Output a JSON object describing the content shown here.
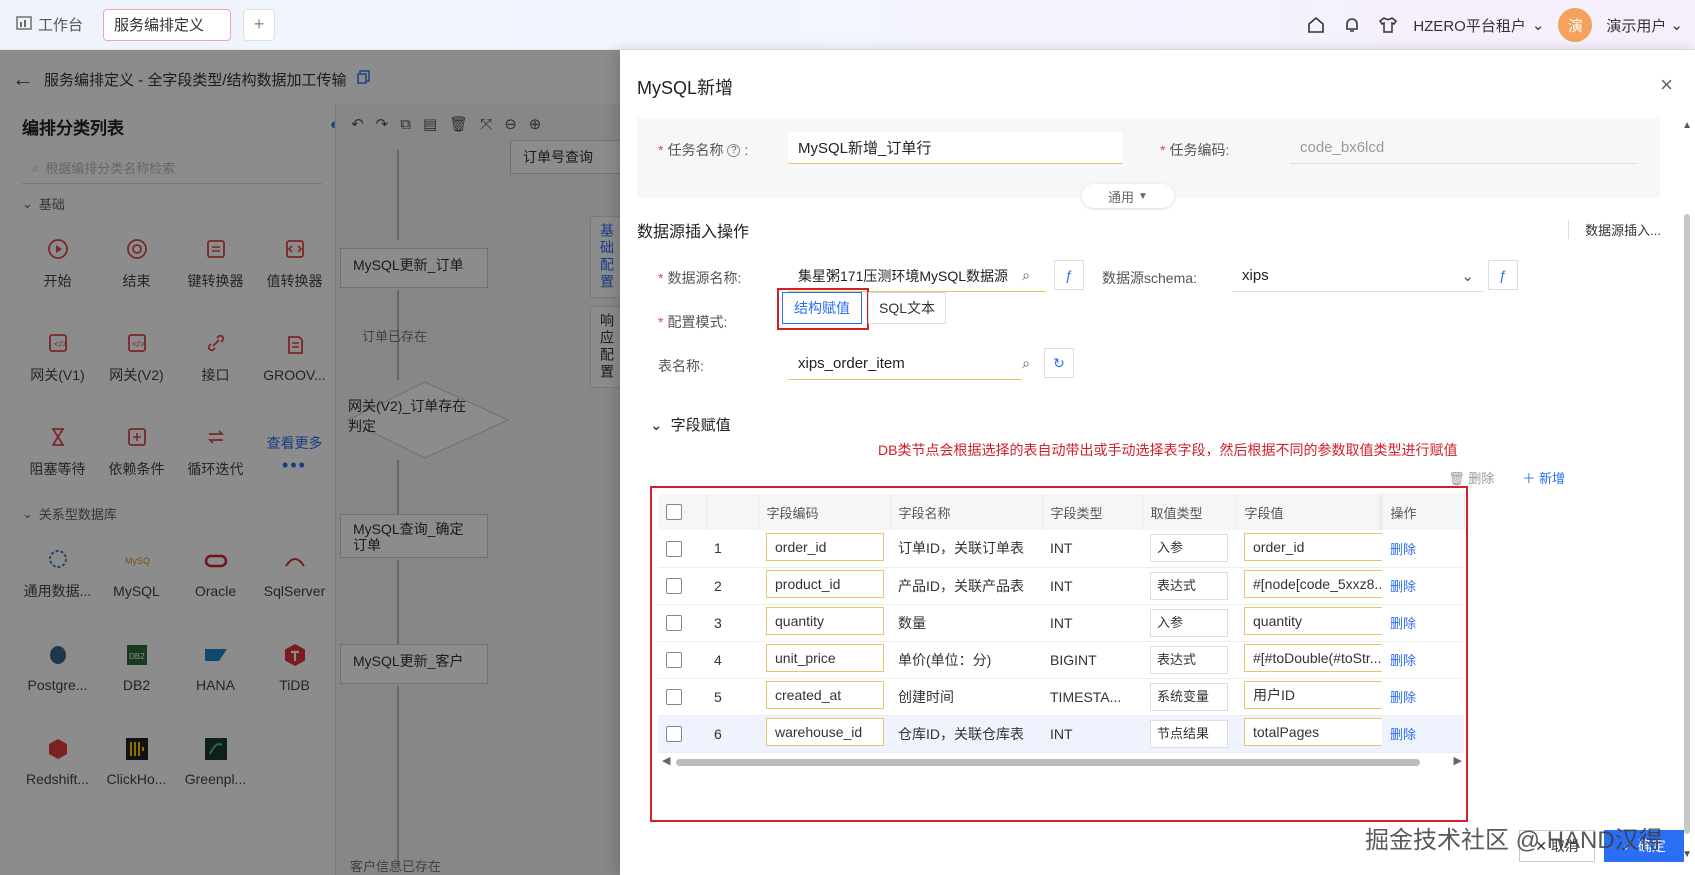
{
  "topbar": {
    "home_tab": "工作台",
    "active_tab": "服务编排定义",
    "add_tab": "+",
    "tenant": "HZERO平台租户",
    "avatar_text": "演",
    "username": "演示用户"
  },
  "breadcrumb": {
    "title": "服务编排定义 - 全字段类型/结构数据加工传输"
  },
  "catalog": {
    "title": "编排分类列表",
    "search_placeholder": "根据编排分类名称检索",
    "group_basic": "基础",
    "basic_items": [
      {
        "label": "开始",
        "icon": "play-circle-icon"
      },
      {
        "label": "结束",
        "icon": "stop-circle-icon"
      },
      {
        "label": "键转换器",
        "icon": "key-convert-icon"
      },
      {
        "label": "值转换器",
        "icon": "value-convert-icon"
      },
      {
        "label": "网关(V1)",
        "icon": "gateway-v1-icon"
      },
      {
        "label": "网关(V2)",
        "icon": "gateway-v2-icon"
      },
      {
        "label": "接口",
        "icon": "link-icon"
      },
      {
        "label": "GROOV...",
        "icon": "groovy-icon"
      },
      {
        "label": "阻塞等待",
        "icon": "hourglass-icon"
      },
      {
        "label": "依赖条件",
        "icon": "dependency-icon"
      },
      {
        "label": "循环迭代",
        "icon": "loop-icon"
      },
      {
        "label": "查看更多",
        "icon": "more-icon"
      }
    ],
    "group_db": "关系型数据库",
    "db_items": [
      {
        "label": "通用数据...",
        "icon": "generic-db-icon"
      },
      {
        "label": "MySQL",
        "icon": "mysql-icon"
      },
      {
        "label": "Oracle",
        "icon": "oracle-icon"
      },
      {
        "label": "SqlServer",
        "icon": "sqlserver-icon"
      },
      {
        "label": "Postgre...",
        "icon": "postgres-icon"
      },
      {
        "label": "DB2",
        "icon": "db2-icon"
      },
      {
        "label": "HANA",
        "icon": "hana-icon"
      },
      {
        "label": "TiDB",
        "icon": "tidb-icon"
      },
      {
        "label": "Redshift...",
        "icon": "redshift-icon"
      },
      {
        "label": "ClickHo...",
        "icon": "clickhouse-icon"
      },
      {
        "label": "Greenpl...",
        "icon": "greenplum-icon"
      }
    ]
  },
  "canvas": {
    "nodes": {
      "top": "订单号查询",
      "n1": "MySQL更新_订单",
      "label1": "订单已存在",
      "n2": "网关(V2)_订单存在判定",
      "n3": "MySQL查询_确定订单",
      "n4": "MySQL更新_客户",
      "label2": "客户信息已存在"
    },
    "side_tabs": [
      "基础配置",
      "响应配置"
    ]
  },
  "drawer": {
    "title": "MySQL新增",
    "task_name_label": "任务名称",
    "task_name_value": "MySQL新增_订单行",
    "task_code_label": "任务编码:",
    "task_code_value": "code_bx6lcd",
    "collapse_label": "通用",
    "section_title": "数据源插入操作",
    "section_link": "数据源插入...",
    "ds_name_label": "数据源名称:",
    "ds_name_value": "集星粥171压测环境MySQL数据源",
    "schema_label": "数据源schema:",
    "schema_value": "xips",
    "mode_label": "配置模式:",
    "mode_struct": "结构赋值",
    "mode_sql": "SQL文本",
    "table_label": "表名称:",
    "table_value": "xips_order_item",
    "field_section": "字段赋值",
    "annotation": "DB类节点会根据选择的表自动带出或手动选择表字段，然后根据不同的参数取值类型进行赋值",
    "delete_label": "删除",
    "add_label": "新增",
    "columns": [
      "字段编码",
      "字段名称",
      "字段类型",
      "取值类型",
      "字段值",
      "操作"
    ],
    "rows": [
      {
        "no": "1",
        "code": "order_id",
        "name": "订单ID，关联订单表",
        "type": "INT",
        "vtype": "入参",
        "value": "order_id",
        "op": "删除"
      },
      {
        "no": "2",
        "code": "product_id",
        "name": "产品ID，关联产品表",
        "type": "INT",
        "vtype": "表达式",
        "value": "#[node[code_5xxz8...",
        "op": "删除"
      },
      {
        "no": "3",
        "code": "quantity",
        "name": "数量",
        "type": "INT",
        "vtype": "入参",
        "value": "quantity",
        "op": "删除"
      },
      {
        "no": "4",
        "code": "unit_price",
        "name": "单价(单位：分)",
        "type": "BIGINT",
        "vtype": "表达式",
        "value": "#[#toDouble(#toStr...",
        "op": "删除"
      },
      {
        "no": "5",
        "code": "created_at",
        "name": "创建时间",
        "type": "TIMESTA...",
        "vtype": "系统变量",
        "value": "用户ID",
        "op": "删除"
      },
      {
        "no": "6",
        "code": "warehouse_id",
        "name": "仓库ID，关联仓库表",
        "type": "INT",
        "vtype": "节点结果",
        "value": "totalPages",
        "op": "删除"
      }
    ],
    "cancel_label": "取消",
    "ok_label": "确定"
  },
  "watermark": "掘金技术社区 @ HAND汉得",
  "colors": {
    "primary": "#2a6ef5",
    "danger": "#d0202a",
    "required": "#e0464e"
  }
}
